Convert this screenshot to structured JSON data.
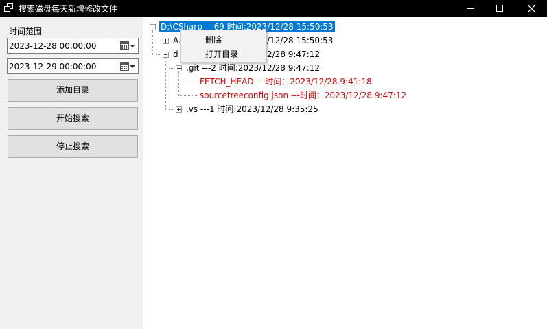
{
  "window": {
    "title": "搜索磁盘每天新增修改文件",
    "icons": {
      "app": "app-icon",
      "minimize": "minimize-icon",
      "maximize": "maximize-icon",
      "close": "close-icon"
    }
  },
  "sidebar": {
    "range_label": "时间范围",
    "start_date": "2023-12-28 00:00:00",
    "end_date": "2023-12-29 00:00:00",
    "buttons": {
      "add_directory": "添加目录",
      "start_search": "开始搜索",
      "stop_search": "停止搜索"
    }
  },
  "tree": {
    "nodes": [
      {
        "text": "D:\\CSharp ---69 时间:2023/12/28 15:50:53",
        "selected": true,
        "expanded": true
      },
      {
        "text_visible_tail": "/12/28 15:50:53",
        "text_visible_head": "A.",
        "expanded": false
      },
      {
        "text_visible_head": "d",
        "text_visible_tail": "2/28 9:47:12",
        "expanded": true
      },
      {
        "text": ".git ---2 时间:2023/12/28 9:47:12",
        "expanded": true
      },
      {
        "text": "FETCH_HEAD ---时间：2023/12/28 9:41:18",
        "color": "#e00000"
      },
      {
        "text": "sourcetreeconfig.json ---时间：2023/12/28 9:47:12",
        "color": "#e00000"
      },
      {
        "text": ".vs ---1 时间:2023/12/28 9:35:25",
        "expanded": false
      }
    ]
  },
  "context_menu": {
    "items": [
      "删除",
      "打开目录"
    ]
  },
  "colors": {
    "selection": "#0078d7",
    "new_file": "#e00000",
    "titlebar": "#000000",
    "panel": "#f0f0f0"
  }
}
